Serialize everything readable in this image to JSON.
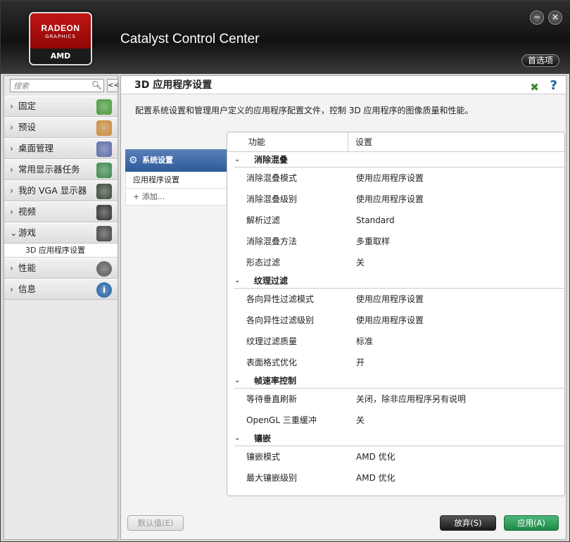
{
  "app": {
    "title": "Catalyst Control Center",
    "logo": {
      "line1": "RADEON",
      "line2": "GRAPHICS",
      "line3": "AMD"
    },
    "preferences": "首选项",
    "minimize": "−",
    "close": "×"
  },
  "sidebar": {
    "search_placeholder": "搜索",
    "collapse": "<<",
    "items": [
      {
        "label": "固定",
        "icon": "pin-icon",
        "color": "#4a9a3a"
      },
      {
        "label": "预设",
        "icon": "preset-icon",
        "color": "#c98a3a"
      },
      {
        "label": "桌面管理",
        "icon": "desktop-icon",
        "color": "#5a6aa8"
      },
      {
        "label": "常用显示器任务",
        "icon": "display-task-icon",
        "color": "#3a8a4a"
      },
      {
        "label": "我的 VGA 显示器",
        "icon": "vga-display-icon",
        "color": "#3a4a3a"
      },
      {
        "label": "视频",
        "icon": "video-camera-icon",
        "color": "#333333"
      },
      {
        "label": "游戏",
        "icon": "gamepad-icon",
        "color": "#444444",
        "expanded": true,
        "children": [
          "3D 应用程序设置"
        ]
      },
      {
        "label": "性能",
        "icon": "gauge-icon",
        "color": "#555555"
      },
      {
        "label": "信息",
        "icon": "info-icon",
        "color": "#1a5fa8"
      }
    ]
  },
  "main": {
    "title": "3D 应用程序设置",
    "description": "配置系统设置和管理用户定义的应用程序配置文件，控制 3D 应用程序的图像质量和性能。",
    "profiles": {
      "selected": "系统设置",
      "items": [
        "应用程序设置"
      ],
      "add": "添加..."
    },
    "grid": {
      "col_feature": "功能",
      "col_setting": "设置",
      "sections": [
        {
          "title": "消除混叠",
          "rows": [
            [
              "消除混叠模式",
              "使用应用程序设置"
            ],
            [
              "消除混叠级别",
              "使用应用程序设置"
            ],
            [
              "解析过滤",
              "Standard"
            ],
            [
              "消除混叠方法",
              "多重取样"
            ],
            [
              "形态过滤",
              "关"
            ]
          ]
        },
        {
          "title": "纹理过滤",
          "rows": [
            [
              "各向异性过滤模式",
              "使用应用程序设置"
            ],
            [
              "各向异性过滤级别",
              "使用应用程序设置"
            ],
            [
              "纹理过滤质量",
              "标准"
            ],
            [
              "表面格式优化",
              "开"
            ]
          ]
        },
        {
          "title": "帧速率控制",
          "rows": [
            [
              "等待垂直刷新",
              "关闭，除非应用程序另有说明"
            ],
            [
              "OpenGL 三重缓冲",
              "关"
            ]
          ]
        },
        {
          "title": "镶嵌",
          "rows": [
            [
              "镶嵌模式",
              "AMD 优化"
            ],
            [
              "最大镶嵌级别",
              "AMD 优化"
            ]
          ]
        }
      ]
    }
  },
  "buttons": {
    "default": "默认值(E)",
    "discard": "放弃(S)",
    "apply": "应用(A)"
  }
}
